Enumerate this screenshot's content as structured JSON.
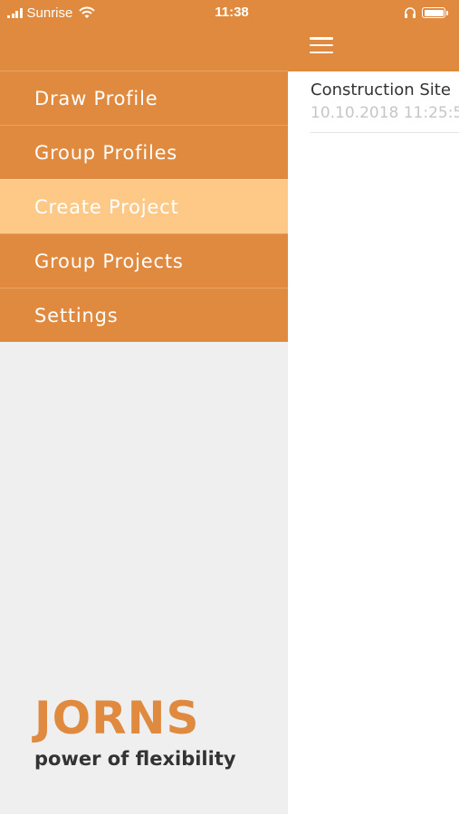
{
  "status_bar": {
    "carrier": "Sunrise",
    "time": "11:38",
    "icons": [
      "signal-icon",
      "wifi-icon",
      "headphones-icon",
      "battery-icon"
    ]
  },
  "drawer": {
    "items": [
      {
        "label": "Draw Profile",
        "active": false
      },
      {
        "label": "Group Profiles",
        "active": false
      },
      {
        "label": "Create Project",
        "active": true
      },
      {
        "label": "Group Projects",
        "active": false
      },
      {
        "label": "Settings",
        "active": false
      }
    ],
    "brand": {
      "logo": "JORNS",
      "tagline": "power of flexibility"
    }
  },
  "main": {
    "menu_icon": "hamburger-menu-icon",
    "projects": [
      {
        "name": "Construction Site",
        "date": "10.10.2018 11:25:5"
      }
    ]
  },
  "colors": {
    "primary": "#e08a3f",
    "active_item": "#fec987",
    "drawer_background": "#efefef",
    "text_dark": "#333333",
    "text_muted": "#c6c6c6"
  }
}
